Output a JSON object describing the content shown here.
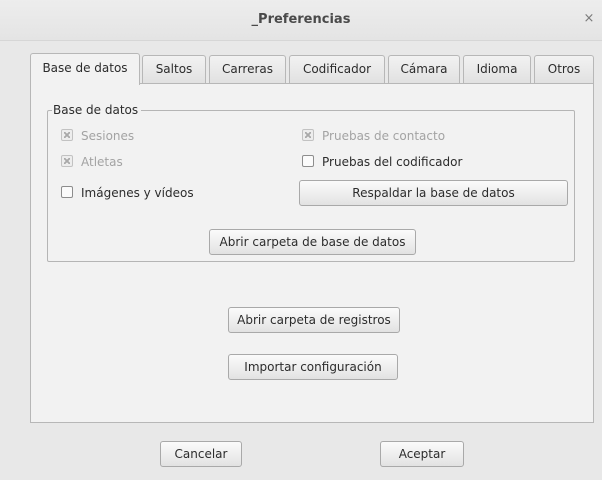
{
  "window": {
    "title": "_Preferencias",
    "close_glyph": "×"
  },
  "tabs": [
    {
      "label": "Base de datos",
      "active": true
    },
    {
      "label": "Saltos",
      "active": false
    },
    {
      "label": "Carreras",
      "active": false
    },
    {
      "label": "Codificador",
      "active": false
    },
    {
      "label": "Cámara",
      "active": false
    },
    {
      "label": "Idioma",
      "active": false
    },
    {
      "label": "Otros",
      "active": false
    }
  ],
  "database_frame": {
    "label": "Base de datos",
    "checks": {
      "sessions": {
        "label": "Sesiones",
        "checked": true,
        "enabled": false
      },
      "athletes": {
        "label": "Atletas",
        "checked": true,
        "enabled": false
      },
      "images_videos": {
        "label": "Imágenes y vídeos",
        "checked": false,
        "enabled": true
      },
      "contact_tests": {
        "label": "Pruebas de contacto",
        "checked": true,
        "enabled": false
      },
      "encoder_tests": {
        "label": "Pruebas del codificador",
        "checked": false,
        "enabled": true
      }
    },
    "backup_button": "Respaldar la base de datos",
    "open_db_folder_button": "Abrir carpeta de base de datos"
  },
  "panel_buttons": {
    "open_logs": "Abrir carpeta de registros",
    "import_config": "Importar configuración"
  },
  "dialog_buttons": {
    "cancel": "Cancelar",
    "accept": "Aceptar"
  }
}
